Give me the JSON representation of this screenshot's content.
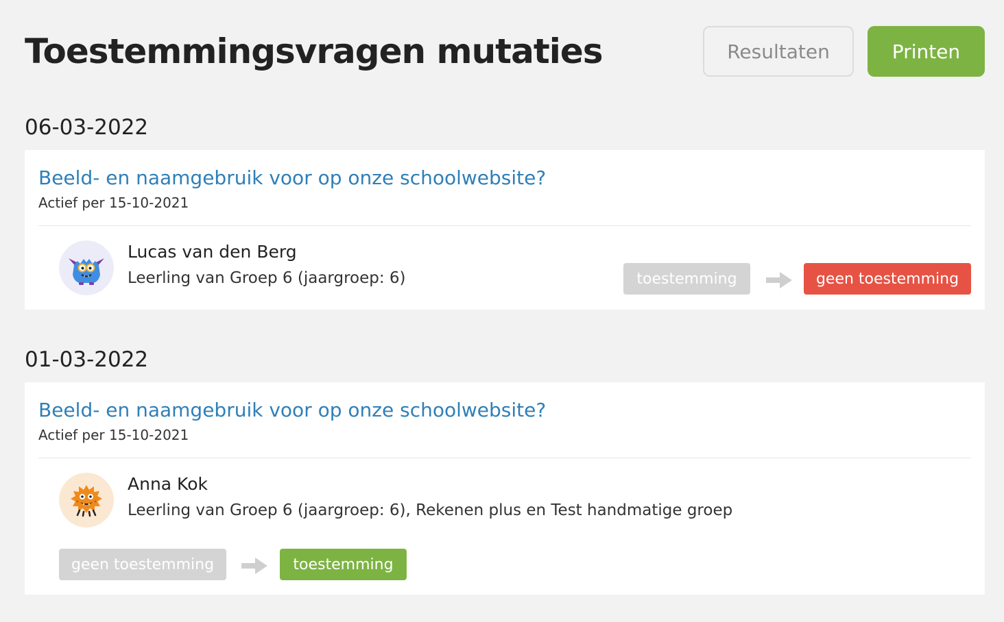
{
  "page": {
    "title": "Toestemmingsvragen mutaties"
  },
  "toolbar": {
    "results_label": "Resultaten",
    "print_label": "Printen"
  },
  "groups": [
    {
      "date": "06-03-2022",
      "question": {
        "title": "Beeld- en naamgebruik voor op onze schoolwebsite?",
        "active": "Actief per 15-10-2021"
      },
      "person": {
        "name": "Lucas van den Berg",
        "description": "Leerling van Groep 6 (jaargroep: 6)",
        "avatar_icon": "blue-monster-avatar-icon"
      },
      "change": {
        "from": "toestemming",
        "to": "geen toestemming",
        "to_status": "denied"
      }
    },
    {
      "date": "01-03-2022",
      "question": {
        "title": "Beeld- en naamgebruik voor op onze schoolwebsite?",
        "active": "Actief per 15-10-2021"
      },
      "person": {
        "name": "Anna Kok",
        "description": "Leerling van Groep 6 (jaargroep: 6), Rekenen plus en Test handmatige groep",
        "avatar_icon": "orange-monster-avatar-icon"
      },
      "change": {
        "from": "geen toestemming",
        "to": "toestemming",
        "to_status": "granted"
      }
    }
  ],
  "colors": {
    "background": "#f2f2f2",
    "link": "#2f7fb8",
    "primary_green": "#7db343",
    "denied_red": "#e65345",
    "previous_grey": "#d4d4d4"
  },
  "icons": {
    "change_arrow": "arrow-right-icon"
  }
}
